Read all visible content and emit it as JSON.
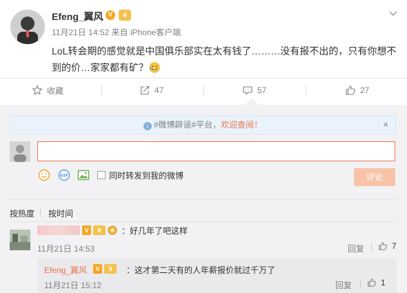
{
  "post": {
    "username": "Efeng_翼风",
    "verified_badge": "V",
    "crown_badge": "♛",
    "meta": "11月21日 14:52 来自 iPhone客户端",
    "content": "LoL转会期的感觉就是中国俱乐部实在太有钱了………没有报不出的，只有你想不到的价…家家都有矿？",
    "icons": {
      "options": "chevron-down-icon",
      "emoji": "laughing-emoji-icon"
    }
  },
  "actions": [
    {
      "icon": "star-icon",
      "label": "收藏"
    },
    {
      "icon": "share-icon",
      "label": "47"
    },
    {
      "icon": "comment-icon",
      "label": "57"
    },
    {
      "icon": "thumbs-up-icon",
      "label": "27"
    }
  ],
  "notice": {
    "prefix": "#微博辟谣#平台，",
    "highlight": "欢迎查阅！",
    "close": "×"
  },
  "composer": {
    "input_value": "",
    "repost_label": "同时转发到我的微博",
    "submit_label": "评论",
    "icons": [
      "smile-icon",
      "gif-icon",
      "image-icon"
    ]
  },
  "sort": {
    "hot": "按热度",
    "time": "按时间"
  },
  "comments": [
    {
      "text": "：好几年了吧这样",
      "time": "11月21日 14:53",
      "reply_label": "回复",
      "likes": "7",
      "replies": [
        {
          "name": "Efeng_翼风",
          "text": "：这才第二天有的人年薪报价就过千万了",
          "time": "11月21日 15:12",
          "reply_label": "回复",
          "likes": "1"
        }
      ]
    }
  ],
  "colors": {
    "accent": "#eb7350",
    "muted": "#808080",
    "panel": "#f2f2f5",
    "badge_gold": "#f5a623"
  }
}
